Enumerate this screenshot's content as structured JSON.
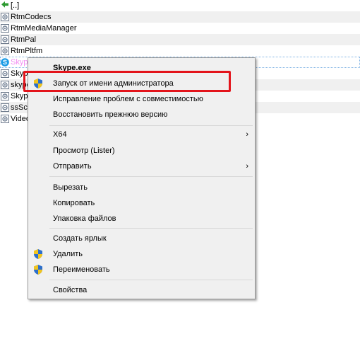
{
  "files": [
    {
      "name": "[..]",
      "icon": "up-folder-arrow-icon",
      "zebra": false,
      "highlight": false
    },
    {
      "name": "RtmCodecs",
      "icon": "file-dll-icon",
      "zebra": true,
      "highlight": false
    },
    {
      "name": "RtmMediaManager",
      "icon": "file-dll-icon",
      "zebra": false,
      "highlight": false
    },
    {
      "name": "RtmPal",
      "icon": "file-dll-icon",
      "zebra": true,
      "highlight": false
    },
    {
      "name": "RtmPltfm",
      "icon": "file-dll-icon",
      "zebra": false,
      "highlight": false
    },
    {
      "name": "Skype",
      "icon": "skype-logo-icon",
      "zebra": true,
      "highlight": true
    },
    {
      "name": "Skyp",
      "icon": "file-dll-icon",
      "zebra": false,
      "highlight": false
    },
    {
      "name": "skype",
      "icon": "file-dll-icon",
      "zebra": true,
      "highlight": false
    },
    {
      "name": "Skyp",
      "icon": "file-dll-icon",
      "zebra": false,
      "highlight": false
    },
    {
      "name": "ssScr",
      "icon": "file-dll-icon",
      "zebra": true,
      "highlight": false
    },
    {
      "name": "Video",
      "icon": "file-dll-icon",
      "zebra": false,
      "highlight": false
    }
  ],
  "context_menu": {
    "header": "Skype.exe",
    "items": {
      "run_as_admin": "Запуск от имени администратора",
      "compat": "Исправление проблем с совместимостью",
      "restore": "Восстановить прежнюю версию",
      "x64": "X64",
      "lister": "Просмотр (Lister)",
      "send": "Отправить",
      "cut": "Вырезать",
      "copy": "Копировать",
      "pack": "Упаковка файлов",
      "shortcut": "Создать ярлык",
      "delete": "Удалить",
      "rename": "Переименовать",
      "properties": "Свойства"
    },
    "submenu_arrow": "›",
    "shield_icon": "uac-shield-icon"
  },
  "colors": {
    "highlight_text": "#f28cf2",
    "annotation_border": "#e3141b",
    "menu_background": "#f0f0f0"
  }
}
